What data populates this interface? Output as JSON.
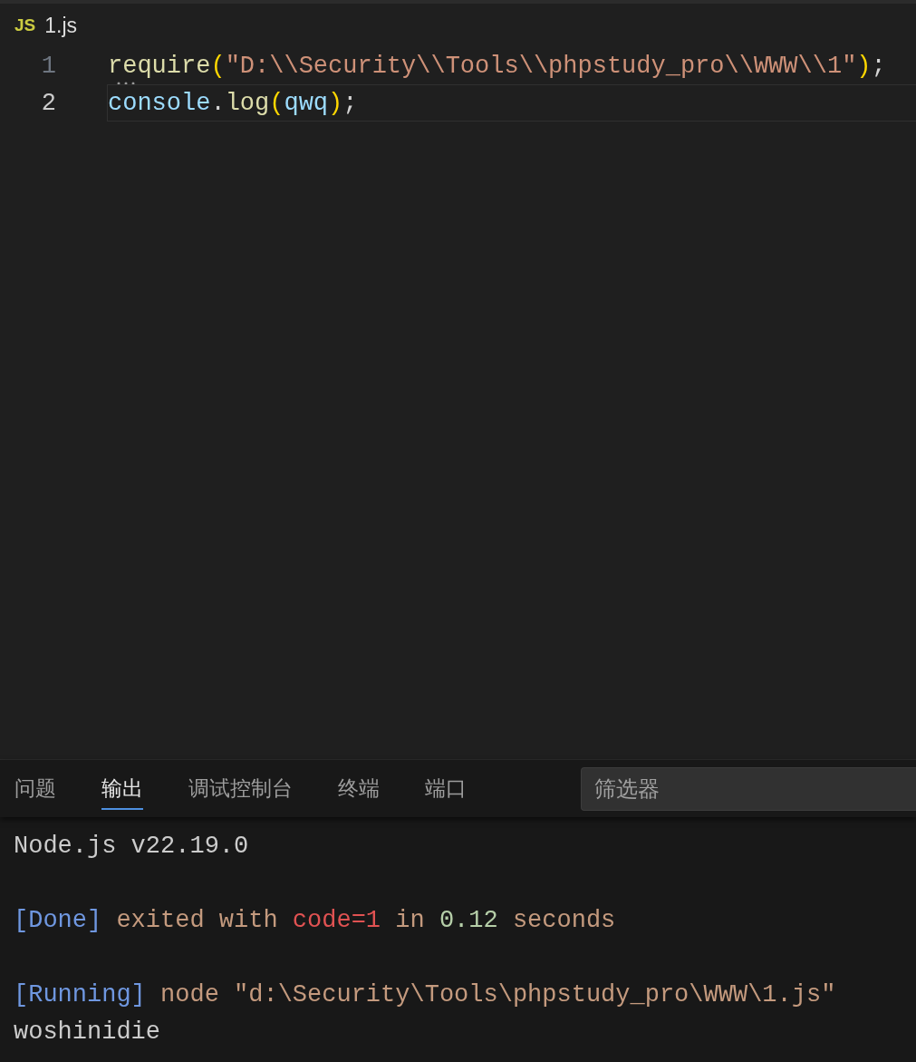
{
  "editor": {
    "tab": {
      "icon": "JS",
      "title": "1.js"
    },
    "lines": [
      {
        "number": "1",
        "current": false,
        "hint": true,
        "tokens": [
          {
            "kind": "function",
            "text": "require"
          },
          {
            "kind": "bracket",
            "text": "("
          },
          {
            "kind": "string",
            "text": "\"D:\\\\Security\\\\Tools\\\\phpstudy_pro\\\\WWW\\\\1\""
          },
          {
            "kind": "bracket",
            "text": ")"
          },
          {
            "kind": "punct",
            "text": ";"
          }
        ]
      },
      {
        "number": "2",
        "current": true,
        "hint": false,
        "tokens": [
          {
            "kind": "variable",
            "text": "console"
          },
          {
            "kind": "punct",
            "text": "."
          },
          {
            "kind": "function",
            "text": "log"
          },
          {
            "kind": "bracket",
            "text": "("
          },
          {
            "kind": "variable",
            "text": "qwq"
          },
          {
            "kind": "bracket",
            "text": ")"
          },
          {
            "kind": "punct",
            "text": ";"
          }
        ]
      }
    ]
  },
  "panel": {
    "tabs": [
      {
        "label": "问题",
        "selected": false
      },
      {
        "label": "输出",
        "selected": true
      },
      {
        "label": "调试控制台",
        "selected": false
      },
      {
        "label": "终端",
        "selected": false
      },
      {
        "label": "端口",
        "selected": false
      }
    ],
    "filter": {
      "placeholder": "筛选器"
    },
    "output_blocks": [
      [
        {
          "tokens": [
            {
              "kind": "plain",
              "text": "Node.js v22.19.0"
            }
          ]
        }
      ],
      [
        {
          "tokens": [
            {
              "kind": "tag",
              "text": "[Done]"
            },
            {
              "kind": "text",
              "text": " exited with "
            },
            {
              "kind": "error",
              "text": "code=1"
            },
            {
              "kind": "text",
              "text": " in "
            },
            {
              "kind": "number",
              "text": "0.12"
            },
            {
              "kind": "text",
              "text": " seconds"
            }
          ]
        }
      ],
      [
        {
          "tokens": [
            {
              "kind": "tag",
              "text": "[Running]"
            },
            {
              "kind": "text",
              "text": " node \"d:\\Security\\Tools\\phpstudy_pro\\WWW\\1.js\""
            }
          ]
        },
        {
          "tokens": [
            {
              "kind": "plain",
              "text": "woshinidie"
            }
          ]
        }
      ]
    ]
  }
}
